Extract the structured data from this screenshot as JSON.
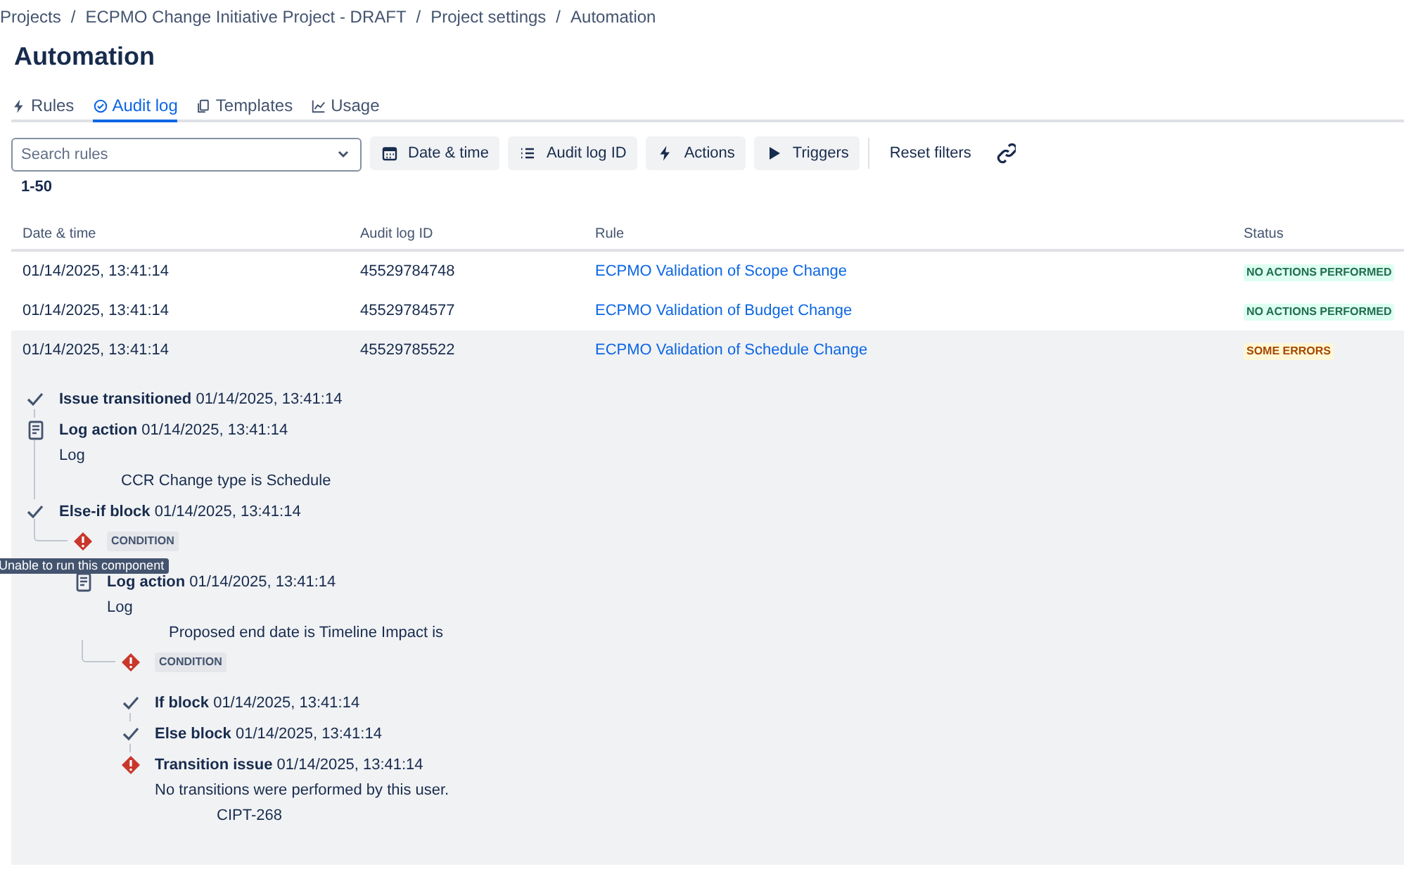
{
  "breadcrumbs": [
    "Projects",
    "/",
    "ECPMO Change Initiative Project - DRAFT",
    "/",
    "Project settings",
    "/",
    "Automation"
  ],
  "title": "Automation",
  "tabs": [
    {
      "label": "Rules",
      "selected": false
    },
    {
      "label": "Audit log",
      "selected": true
    },
    {
      "label": "Templates",
      "selected": false
    },
    {
      "label": "Usage",
      "selected": false
    }
  ],
  "filters": {
    "search": {
      "placeholder": "Search rules"
    },
    "buttons": [
      "Date & time",
      "Audit log ID",
      "Actions",
      "Triggers"
    ],
    "reset": "Reset filters"
  },
  "range": "1-50",
  "table": {
    "columns": [
      "Date & time",
      "Audit log ID",
      "Rule",
      "Status"
    ],
    "rows": [
      {
        "date": "01/14/2025, 13:41:14",
        "id": "45529784748",
        "rule": "ECPMO Validation of Scope Change",
        "status": {
          "label": "NO ACTIONS PERFORMED",
          "kind": "success"
        },
        "expanded": false
      },
      {
        "date": "01/14/2025, 13:41:14",
        "id": "45529784577",
        "rule": "ECPMO Validation of Budget Change",
        "status": {
          "label": "NO ACTIONS PERFORMED",
          "kind": "success"
        },
        "expanded": false
      },
      {
        "date": "01/14/2025, 13:41:14",
        "id": "45529785522",
        "rule": "ECPMO Validation of Schedule Change",
        "status": {
          "label": "SOME ERRORS",
          "kind": "warning"
        },
        "expanded": true,
        "details": [
          {
            "kind": "success",
            "title": "Issue transitioned",
            "time": "01/14/2025, 13:41:14"
          },
          {
            "kind": "log",
            "title": "Log action",
            "time": "01/14/2025, 13:41:14",
            "detail": "Log",
            "message": "CCR Change type is Schedule"
          },
          {
            "kind": "success",
            "title": "Else-if block",
            "time": "01/14/2025, 13:41:14",
            "children": [
              {
                "kind": "condition",
                "label": "CONDITION",
                "tooltip": "Unable to run this component",
                "children": [
                  {
                    "kind": "log",
                    "title": "Log action",
                    "time": "01/14/2025, 13:41:14",
                    "detail": "Log",
                    "message": "Proposed end date is Timeline Impact is",
                    "children": [
                      {
                        "kind": "condition",
                        "label": "CONDITION",
                        "children": [
                          {
                            "kind": "success",
                            "title": "If block",
                            "time": "01/14/2025, 13:41:14"
                          },
                          {
                            "kind": "success",
                            "title": "Else block",
                            "time": "01/14/2025, 13:41:14"
                          },
                          {
                            "kind": "error",
                            "title": "Transition issue",
                            "time": "01/14/2025, 13:41:14",
                            "detail": "No transitions were performed by this user.",
                            "message": "CIPT-268"
                          }
                        ]
                      }
                    ]
                  }
                ]
              }
            ]
          }
        ]
      }
    ]
  }
}
